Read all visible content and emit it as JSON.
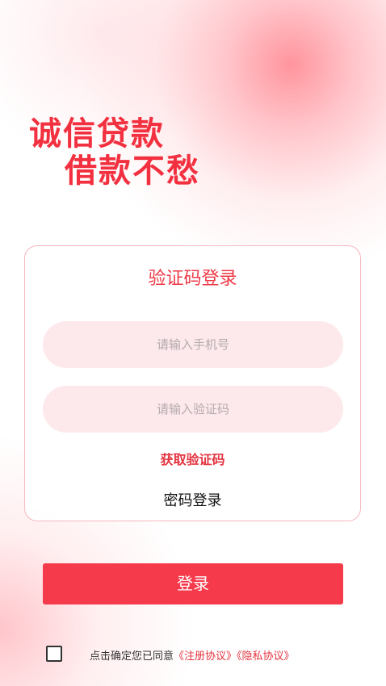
{
  "brand": {
    "slogan_line1": "诚信贷款",
    "slogan_line2": "借款不愁"
  },
  "login_card": {
    "title": "验证码登录",
    "phone_placeholder": "请输入手机号",
    "code_placeholder": "请输入验证码",
    "get_code_label": "获取验证码",
    "password_login_label": "密码登录"
  },
  "login_button": {
    "label": "登录"
  },
  "agreement": {
    "checked": false,
    "prefix_text": "点击确定您已同意",
    "register_link": "《注册协议》",
    "privacy_link": "《隐私协议》"
  },
  "colors": {
    "accent": "#f43a4b",
    "field_bg": "#fde9ec",
    "card_border": "#f6b8bf"
  }
}
